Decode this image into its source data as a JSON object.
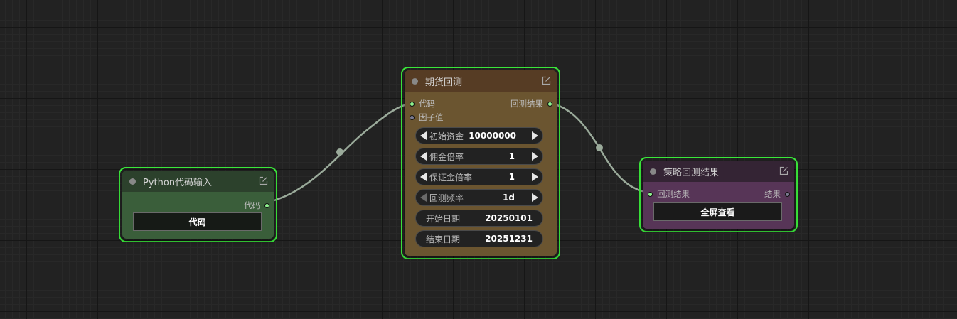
{
  "nodes": {
    "python_input": {
      "title": "Python代码输入",
      "output_label": "代码",
      "button_label": "代码",
      "color_header": "#2c412c",
      "color_body": "#3a5e3a"
    },
    "futures_backtest": {
      "title": "期货回测",
      "inputs": [
        "代码",
        "因子值"
      ],
      "output_label": "回测结果",
      "widgets": [
        {
          "label": "初始资金",
          "value": "10000000"
        },
        {
          "label": "佣金倍率",
          "value": "1"
        },
        {
          "label": "保证金倍率",
          "value": "1"
        },
        {
          "label": "回测频率",
          "value": "1d"
        },
        {
          "label": "开始日期",
          "value": "20250101"
        },
        {
          "label": "结束日期",
          "value": "20251231"
        }
      ],
      "color_header": "#563c24",
      "color_body": "#6b5530"
    },
    "strategy_result": {
      "title": "策略回测结果",
      "input_label": "回测结果",
      "output_label": "结果",
      "button_label": "全屏查看",
      "color_header": "#342434",
      "color_body": "#573557"
    }
  },
  "colors": {
    "canvas": "#222222",
    "selected_border": "#3be93b",
    "link": "#9aaa9a",
    "connected_slot": "#8ef28e"
  }
}
